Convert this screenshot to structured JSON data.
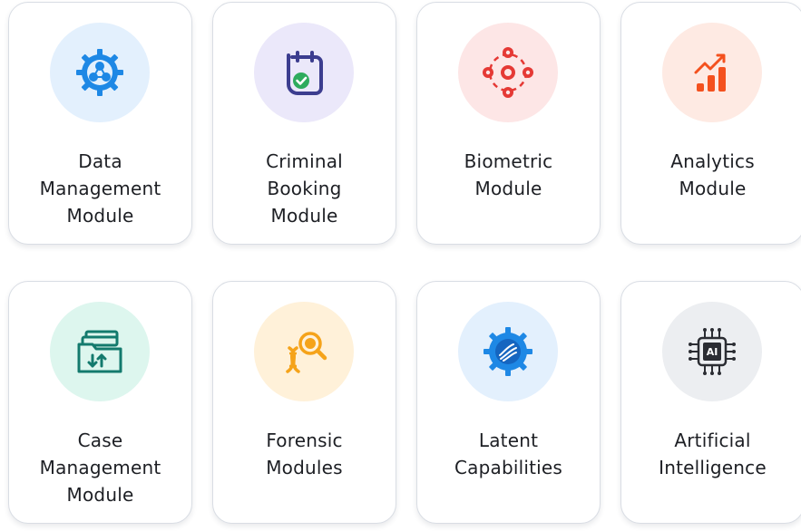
{
  "modules": [
    {
      "id": "data-management",
      "lines": [
        "Data",
        "Management",
        "Module"
      ],
      "icon": "network-gear-icon",
      "circle_color": "#e3f0fd",
      "icon_color": "#1e88e5"
    },
    {
      "id": "criminal-booking",
      "lines": [
        "Criminal",
        "Booking",
        "Module"
      ],
      "icon": "booking-calendar-icon",
      "circle_color": "#ebe8fa",
      "icon_color": "#3c3d8f"
    },
    {
      "id": "biometric",
      "lines": [
        "Biometric",
        "Module"
      ],
      "icon": "biometric-icon",
      "circle_color": "#fde6e6",
      "icon_color": "#e53935"
    },
    {
      "id": "analytics",
      "lines": [
        "Analytics",
        "Module"
      ],
      "icon": "analytics-chart-icon",
      "circle_color": "#feeae3",
      "icon_color": "#f4511e"
    },
    {
      "id": "case-management",
      "lines": [
        "Case",
        "Management",
        "Module"
      ],
      "icon": "case-folder-icon",
      "circle_color": "#ddf6ee",
      "icon_color": "#137a6d"
    },
    {
      "id": "forensic",
      "lines": [
        "Forensic",
        "Modules"
      ],
      "icon": "dna-magnifier-icon",
      "circle_color": "#fff1d9",
      "icon_color": "#f5a31a"
    },
    {
      "id": "latent",
      "lines": [
        "Latent",
        "Capabilities"
      ],
      "icon": "fingerprint-gear-icon",
      "circle_color": "#e3f0fd",
      "icon_color": "#1e88e5"
    },
    {
      "id": "ai",
      "lines": [
        "Artificial",
        "Intelligence"
      ],
      "icon": "ai-chip-icon",
      "circle_color": "#eceef1",
      "icon_color": "#2b2d33"
    }
  ]
}
